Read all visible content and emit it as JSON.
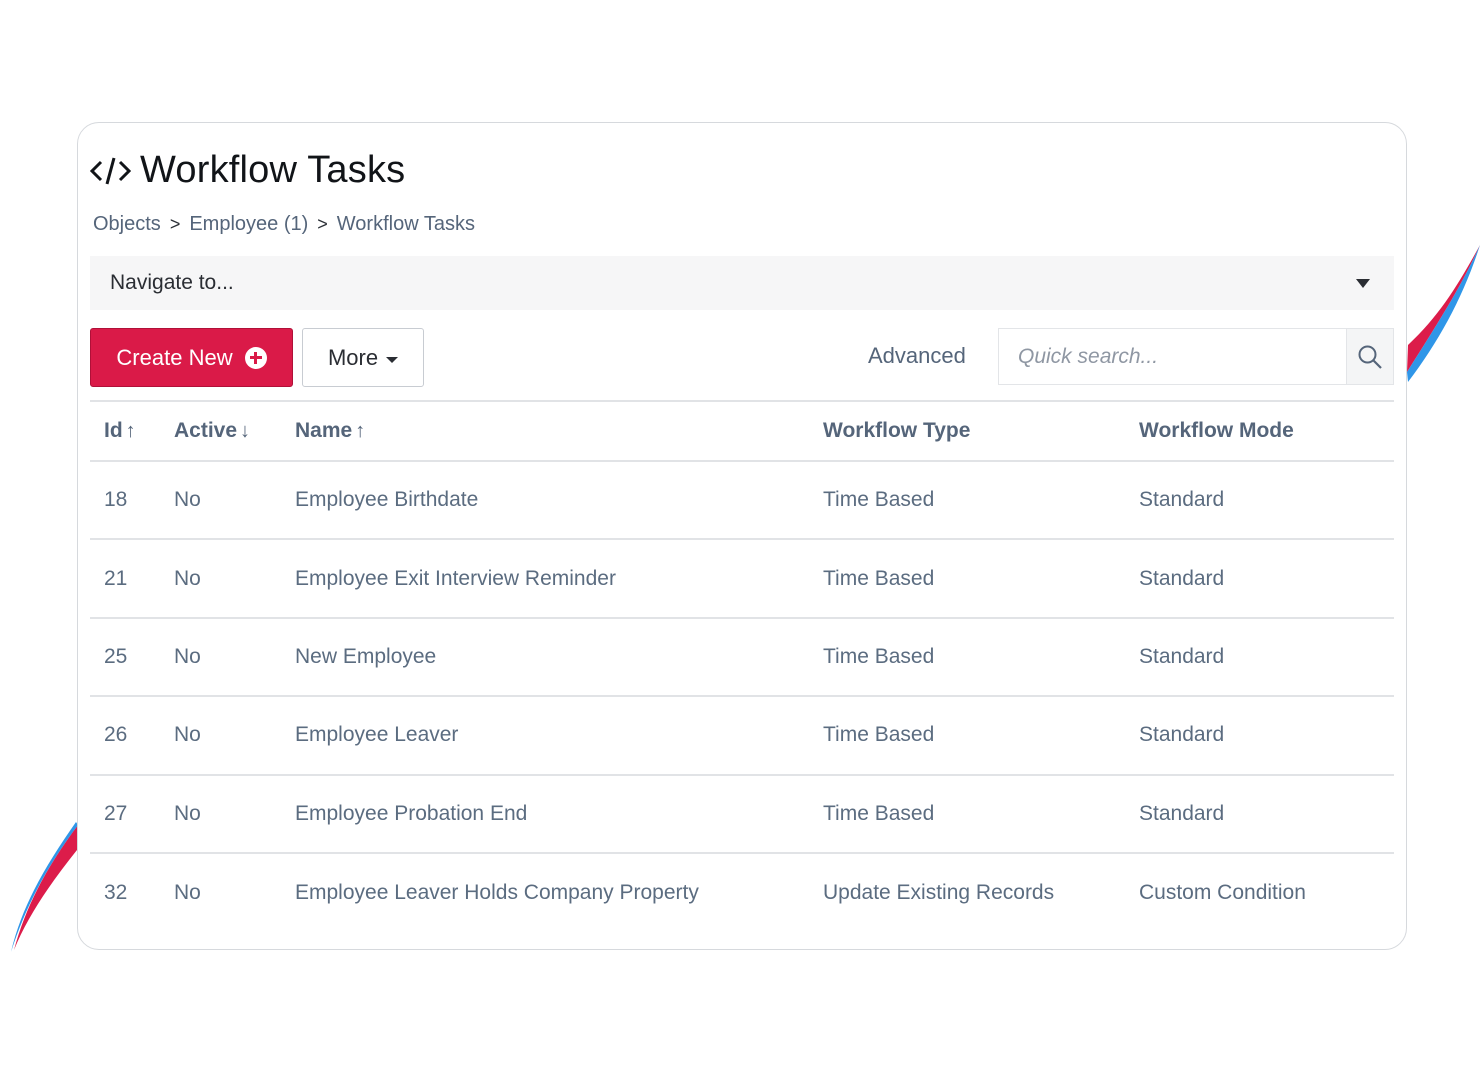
{
  "colors": {
    "primary": "#da1a48",
    "accent_blue": "#2f96e8",
    "text_muted": "#55657a"
  },
  "header": {
    "title": "Workflow Tasks",
    "icon": "code-icon"
  },
  "breadcrumb": {
    "items": [
      "Objects",
      "Employee (1)",
      "Workflow Tasks"
    ],
    "separator": ">"
  },
  "navigate": {
    "label": "Navigate to..."
  },
  "toolbar": {
    "create_label": "Create New",
    "more_label": "More",
    "advanced_label": "Advanced",
    "search_placeholder": "Quick search..."
  },
  "table": {
    "columns": [
      {
        "label": "Id",
        "sort": "↑"
      },
      {
        "label": "Active",
        "sort": "↓"
      },
      {
        "label": "Name",
        "sort": "↑"
      },
      {
        "label": "Workflow Type",
        "sort": ""
      },
      {
        "label": "Workflow Mode",
        "sort": ""
      }
    ],
    "rows": [
      [
        "18",
        "No",
        "Employee Birthdate",
        "Time Based",
        "Standard"
      ],
      [
        "21",
        "No",
        "Employee Exit Interview Reminder",
        "Time Based",
        "Standard"
      ],
      [
        "25",
        "No",
        "New Employee",
        "Time Based",
        "Standard"
      ],
      [
        "26",
        "No",
        "Employee Leaver",
        "Time Based",
        "Standard"
      ],
      [
        "27",
        "No",
        "Employee Probation End",
        "Time Based",
        "Standard"
      ],
      [
        "32",
        "No",
        "Employee Leaver Holds Company Property",
        "Update Existing Records",
        "Custom Condition"
      ]
    ]
  }
}
